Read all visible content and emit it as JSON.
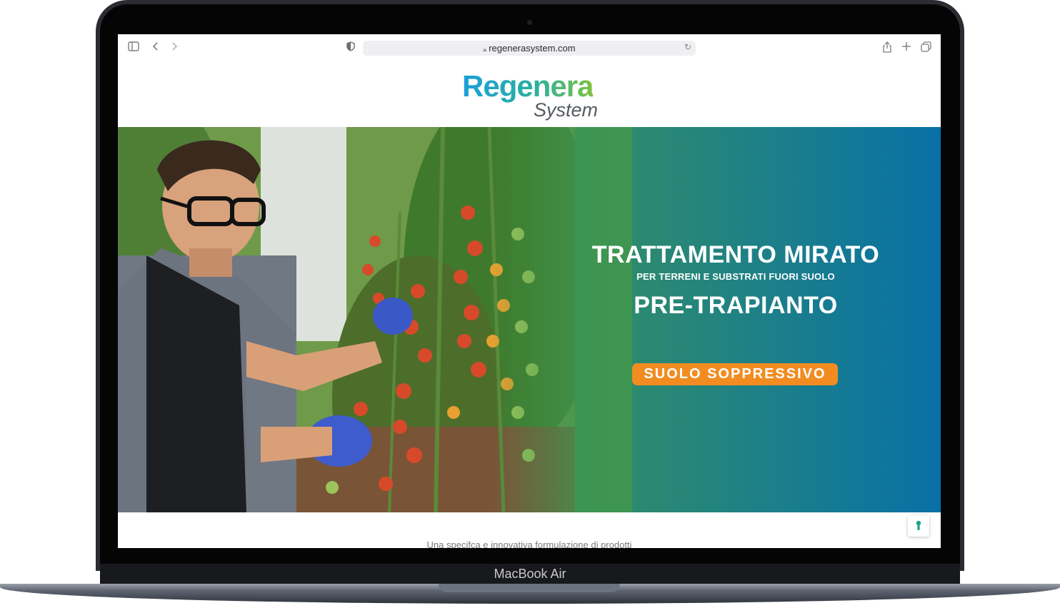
{
  "browser": {
    "url": "regenerasystem.com",
    "icons": {
      "sidebar": "sidebar-icon",
      "back": "chevron-left-icon",
      "forward": "chevron-right-icon",
      "privacy": "shield-icon",
      "lock": "lock-icon",
      "reload": "reload-icon",
      "share": "share-icon",
      "new_tab": "plus-icon",
      "tabs": "tabs-overview-icon"
    }
  },
  "site": {
    "logo": {
      "line1": "Regenera",
      "line2": "System"
    },
    "hero": {
      "title": "TRATTAMENTO MIRATO",
      "subtitle": "PER TERRENI E SUBSTRATI FUORI SUOLO",
      "title2": "PRE-TRAPIANTO",
      "cta": "SUOLO SOPPRESSIVO",
      "colors": {
        "teal": "#2d8a6e",
        "blue": "#0870a7",
        "green": "#4f8a3a",
        "cta": "#f28c21"
      }
    },
    "intro_text": "Una specifca e innovativa formulazione di prodotti"
  },
  "device": {
    "label": "MacBook Air"
  }
}
